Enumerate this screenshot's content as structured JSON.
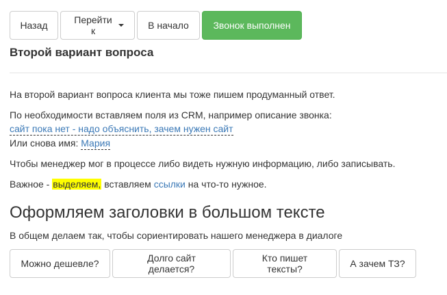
{
  "toolbar": {
    "back_label": "Назад",
    "goto_label": "Перейти к",
    "home_label": "В начало",
    "call_done_label": "Звонок выполнен"
  },
  "section": {
    "title": "Второй вариант вопроса"
  },
  "content": {
    "line1": "На второй вариант вопроса клиента мы тоже пишем продуманный ответ.",
    "line2": "По необходимости вставляем поля из CRM, например описание звонка:",
    "crm_description": "сайт пока нет - надо объяснить, зачем нужен сайт",
    "name_prefix": "Или снова имя:",
    "name_value": "Мария",
    "line4": "Чтобы менеджер мог в процессе либо видеть нужную информацию, либо записывать.",
    "important_prefix": "Важное -",
    "important_highlight": "выделяем,",
    "important_middle": "вставляем",
    "important_link": "ссылки",
    "important_suffix": "на что-то нужное."
  },
  "headings": {
    "big_title": "Оформляем заголовки в большом тексте",
    "subtitle": "В общем делаем так, чтобы сориентировать нашего менеджера в диалоге"
  },
  "answers": [
    {
      "label": "Можно дешевле?"
    },
    {
      "label": "Долго сайт делается?"
    },
    {
      "label": "Кто пишет тексты?"
    },
    {
      "label": "А зачем ТЗ?"
    }
  ],
  "colors": {
    "success": "#5cb85c",
    "link": "#3a78b6",
    "highlight": "#ffff00"
  },
  "icons": {
    "dropdown": "caret-down-icon"
  }
}
